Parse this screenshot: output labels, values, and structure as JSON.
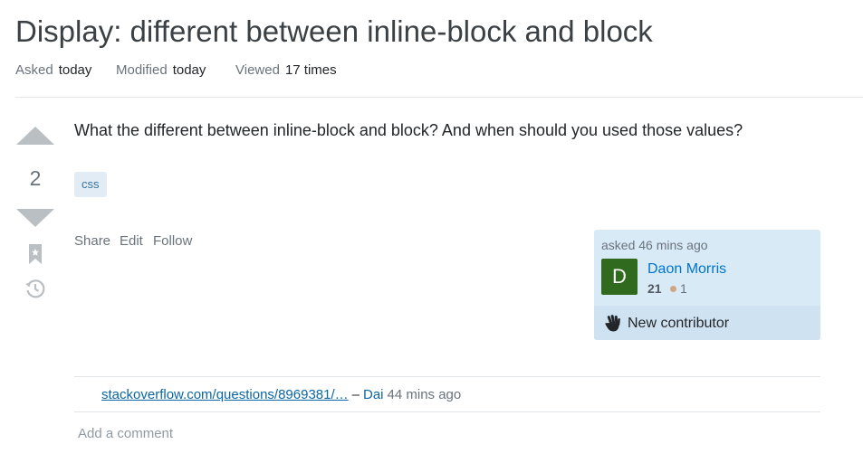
{
  "question": {
    "title": "Display: different between inline-block and block",
    "meta": {
      "asked_label": "Asked",
      "asked_value": "today",
      "modified_label": "Modified",
      "modified_value": "today",
      "viewed_label": "Viewed",
      "viewed_value": "17 times"
    },
    "score": "2",
    "body": "What the different between inline-block and block? And when should you used those values?",
    "tags": [
      "css"
    ]
  },
  "post_menu": {
    "share": "Share",
    "edit": "Edit",
    "follow": "Follow"
  },
  "user_card": {
    "asked_time": "asked 46 mins ago",
    "avatar_letter": "D",
    "avatar_color": "#2f6a1e",
    "name": "Daon Morris",
    "reputation": "21",
    "bronze_badges": "1",
    "new_contributor_label": "New contributor",
    "new_contributor_icon": "wave-hand-icon"
  },
  "comments": [
    {
      "link_text": "stackoverflow.com/questions/8969381/…",
      "dash": "–",
      "user": "Dai",
      "time": "44 mins ago"
    }
  ],
  "add_comment_label": "Add a comment",
  "colors": {
    "link": "#0074cc",
    "tag_bg": "#e1ecf4",
    "tag_text": "#39739d",
    "card_bg": "#d9eaf7",
    "vote_arrow": "#babfc4"
  },
  "icons": {
    "upvote": "upvote-arrow-icon",
    "downvote": "downvote-arrow-icon",
    "bookmark": "bookmark-icon",
    "history": "history-icon"
  }
}
